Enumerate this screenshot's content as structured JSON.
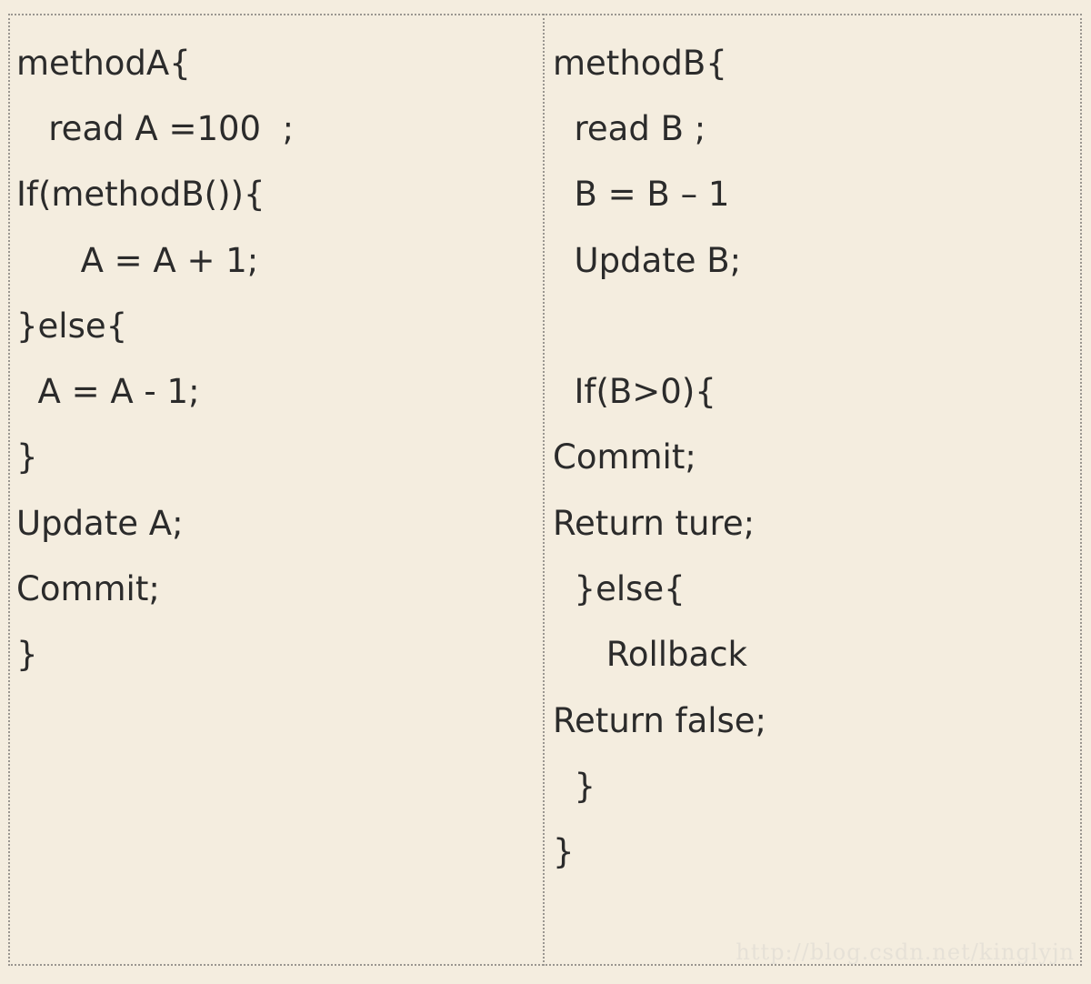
{
  "method_a": {
    "lines": [
      "methodA{",
      "   read A =100  ;",
      "If(methodB()){",
      "      A = A + 1;",
      "}else{",
      "  A = A - 1;",
      "}",
      "Update A;",
      "Commit;",
      "}"
    ]
  },
  "method_b": {
    "lines": [
      "methodB{",
      "  read B ;",
      "  B = B – 1",
      "  Update B;",
      "",
      "  If(B>0){",
      "Commit;",
      "Return ture;",
      "  }else{",
      "     Rollback",
      "Return false;",
      "  }",
      "}"
    ]
  },
  "watermark": {
    "text": "http://blog.csdn.net/kinglyjn"
  }
}
